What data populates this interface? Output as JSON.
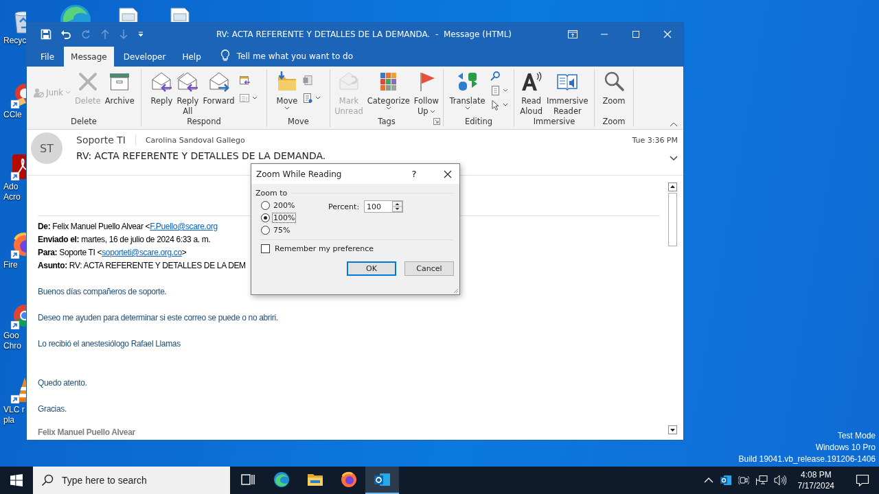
{
  "desktop": {
    "icons": [
      {
        "label": [
          "Recyc"
        ]
      },
      {
        "label": [
          "CCle"
        ]
      },
      {
        "label": [
          "Ado",
          "Acro"
        ]
      },
      {
        "label": [
          "Fire"
        ]
      },
      {
        "label": [
          "Goo",
          "Chro"
        ]
      },
      {
        "label": [
          "VLC r",
          "pla"
        ]
      }
    ],
    "system_info": [
      "Test Mode",
      "Windows 10 Pro",
      "Build 19041.vb_release.191206-1406"
    ]
  },
  "window": {
    "title": "RV: ACTA REFERENTE Y DETALLES DE LA DEMANDA.  -  Message (HTML)",
    "tabs": [
      {
        "label": "File",
        "selected": false
      },
      {
        "label": "Message",
        "selected": true
      },
      {
        "label": "Developer",
        "selected": false
      },
      {
        "label": "Help",
        "selected": false
      }
    ],
    "tell_me": "Tell me what you want to do",
    "ribbon": {
      "groups": [
        {
          "label": "Delete",
          "launcher": false,
          "items": [
            {
              "kind": "small",
              "label": "Junk",
              "disabled": true,
              "menu": true
            },
            {
              "kind": "large",
              "lines": [
                "Delete"
              ],
              "disabled": true,
              "menu": false
            },
            {
              "kind": "large",
              "lines": [
                "Archive"
              ],
              "disabled": false,
              "menu": false
            }
          ]
        },
        {
          "label": "Respond",
          "launcher": false,
          "items": [
            {
              "kind": "large",
              "lines": [
                "Reply"
              ],
              "disabled": false,
              "menu": false
            },
            {
              "kind": "large",
              "lines": [
                "Reply",
                "All"
              ],
              "disabled": false,
              "menu": false
            },
            {
              "kind": "large",
              "lines": [
                "Forward"
              ],
              "disabled": false,
              "menu": false
            },
            {
              "kind": "stack",
              "buttons": [
                {
                  "disabled": false,
                  "menu": false
                },
                {
                  "disabled": false,
                  "menu": true
                }
              ]
            }
          ]
        },
        {
          "label": "Move",
          "launcher": false,
          "items": [
            {
              "kind": "large",
              "lines": [
                "Move"
              ],
              "disabled": false,
              "menu": true
            },
            {
              "kind": "stack",
              "buttons": [
                {
                  "disabled": false,
                  "menu": false
                },
                {
                  "disabled": false,
                  "menu": true
                }
              ]
            }
          ]
        },
        {
          "label": "Tags",
          "launcher": true,
          "items": [
            {
              "kind": "large",
              "lines": [
                "Mark",
                "Unread"
              ],
              "disabled": true,
              "menu": false
            },
            {
              "kind": "large",
              "lines": [
                "Categorize"
              ],
              "disabled": false,
              "menu": true
            },
            {
              "kind": "large",
              "lines": [
                "Follow",
                "Up"
              ],
              "disabled": false,
              "menu": true
            }
          ]
        },
        {
          "label": "Editing",
          "launcher": false,
          "items": [
            {
              "kind": "large",
              "lines": [
                "Translate"
              ],
              "disabled": false,
              "menu": true
            },
            {
              "kind": "stack",
              "buttons": [
                {
                  "disabled": false,
                  "menu": false
                },
                {
                  "disabled": false,
                  "menu": true
                },
                {
                  "disabled": false,
                  "menu": true
                }
              ]
            }
          ]
        },
        {
          "label": "Immersive",
          "launcher": false,
          "items": [
            {
              "kind": "large",
              "lines": [
                "Read",
                "Aloud"
              ],
              "disabled": false,
              "menu": false
            },
            {
              "kind": "large",
              "lines": [
                "Immersive",
                "Reader"
              ],
              "disabled": false,
              "menu": false
            }
          ]
        },
        {
          "label": "Zoom",
          "launcher": false,
          "items": [
            {
              "kind": "large",
              "lines": [
                "Zoom"
              ],
              "disabled": false,
              "menu": false
            }
          ]
        }
      ]
    },
    "message": {
      "avatar": "ST",
      "sender": "Soporte TI",
      "recipient": "Carolina Sandoval Gallego",
      "time": "Tue 3:36 PM",
      "subject": "RV: ACTA REFERENTE Y DETALLES DE LA DEMANDA.",
      "header_lines": [
        {
          "label": "De:",
          "text": "Felix Manuel Puello Alvear <",
          "link": "F.Puello@scare.org"
        },
        {
          "label": "Enviado el:",
          "text": "martes, 16 de julio de 2024 6:33 a. m."
        },
        {
          "label": "Para:",
          "text": "Soporte TI <",
          "link": "soporteti@scare.org.co",
          "after": ">"
        },
        {
          "label": "Asunto:",
          "text": "RV: ACTA REFERENTE Y DETALLES DE LA DEM"
        }
      ],
      "paragraphs": [
        {
          "kind": "body",
          "text": "Buenos días compañeros de soporte."
        },
        {
          "kind": "body",
          "text": "Deseo me ayuden para determinar si este correo se puede o no abriri."
        },
        {
          "kind": "body",
          "text": "Lo recibió el anestesiólogo Rafael Llamas"
        },
        {
          "kind": "body",
          "text": "Quedo atento."
        },
        {
          "kind": "body",
          "text": "Gracias."
        },
        {
          "kind": "signature",
          "text": "Felix Manuel Puello Alvear"
        }
      ]
    }
  },
  "dialog": {
    "title": "Zoom While Reading",
    "help": "?",
    "group_label": "Zoom to",
    "options": [
      {
        "label": "200%",
        "selected": false,
        "focused": false
      },
      {
        "label": "100%",
        "selected": true,
        "focused": true
      },
      {
        "label": "75%",
        "selected": false,
        "focused": false
      }
    ],
    "percent_label": "Percent:",
    "percent_value": "100",
    "remember": {
      "label": "Remember my preference",
      "checked": false
    },
    "buttons": [
      {
        "label": "OK",
        "default": true
      },
      {
        "label": "Cancel",
        "default": false
      }
    ]
  },
  "taskbar": {
    "search_placeholder": "Type here to search",
    "apps": [
      {
        "active": false
      },
      {
        "active": false
      },
      {
        "active": false
      },
      {
        "active": false
      },
      {
        "active": true
      }
    ],
    "time": "4:08 PM",
    "date": "7/17/2024"
  }
}
